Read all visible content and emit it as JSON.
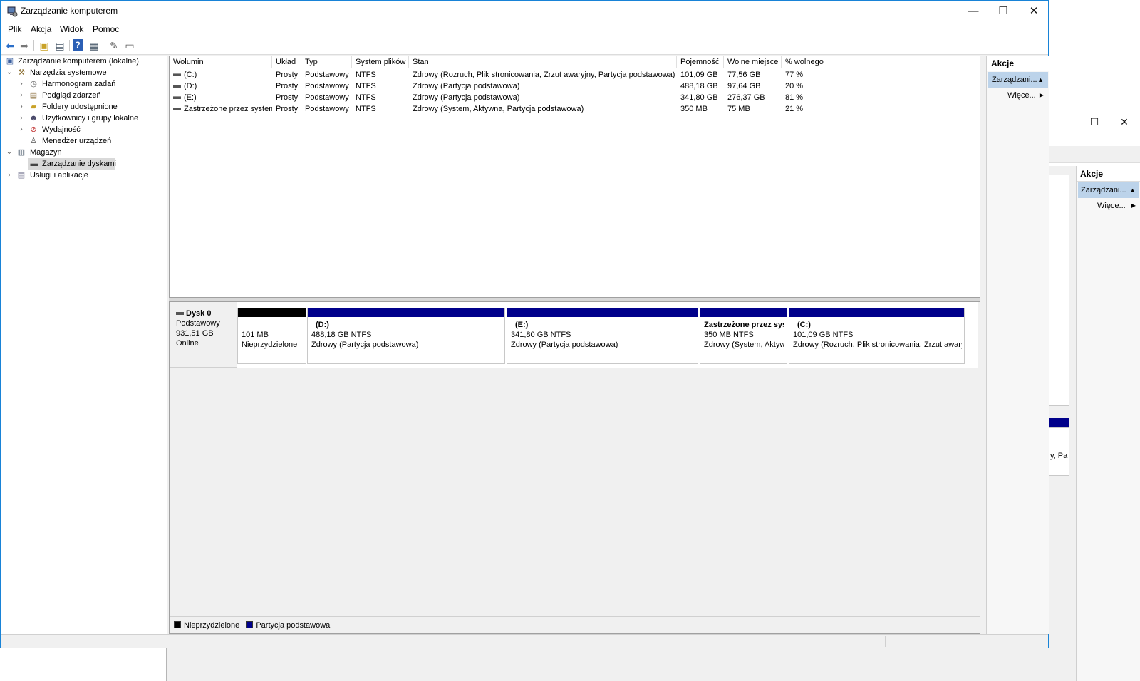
{
  "window": {
    "title": "Zarządzanie komputerem",
    "minimize": "—",
    "maximize": "☐",
    "close": "✕"
  },
  "menu": [
    "Plik",
    "Akcja",
    "Widok",
    "Pomoc"
  ],
  "tree": {
    "root": "Zarządzanie komputerem (lokalne)",
    "items": [
      {
        "label": "Narzędzia systemowe"
      },
      {
        "label": "Harmonogram zadań"
      },
      {
        "label": "Podgląd zdarzeń"
      },
      {
        "label": "Foldery udostępnione"
      },
      {
        "label": "Użytkownicy i grupy lokalne"
      },
      {
        "label": "Wydajność"
      },
      {
        "label": "Menedżer urządzeń"
      },
      {
        "label": "Magazyn"
      },
      {
        "label": "Zarządzanie dyskami"
      },
      {
        "label": "Usługi i aplikacje"
      }
    ]
  },
  "volumes": {
    "columns": [
      "Wolumin",
      "Układ",
      "Typ",
      "System plików",
      "Stan",
      "Pojemność",
      "Wolne miejsce",
      "% wolnego"
    ],
    "rows": [
      [
        "(C:)",
        "Prosty",
        "Podstawowy",
        "NTFS",
        "Zdrowy (Rozruch, Plik stronicowania, Zrzut awaryjny, Partycja podstawowa)",
        "101,09 GB",
        "77,56 GB",
        "77 %"
      ],
      [
        "(D:)",
        "Prosty",
        "Podstawowy",
        "NTFS",
        "Zdrowy (Partycja podstawowa)",
        "488,18 GB",
        "97,64 GB",
        "20 %"
      ],
      [
        "(E:)",
        "Prosty",
        "Podstawowy",
        "NTFS",
        "Zdrowy (Partycja podstawowa)",
        "341,80 GB",
        "276,37 GB",
        "81 %"
      ],
      [
        "Zastrzeżone przez system",
        "Prosty",
        "Podstawowy",
        "NTFS",
        "Zdrowy (System, Aktywna, Partycja podstawowa)",
        "350 MB",
        "75 MB",
        "21 %"
      ]
    ]
  },
  "disk": {
    "name": "Dysk 0",
    "type": "Podstawowy",
    "size": "931,51 GB",
    "status": "Online",
    "partitions": [
      {
        "title": "",
        "size": "101 MB",
        "status": "Nieprzydzielone",
        "color": "#000000"
      },
      {
        "title": "(D:)",
        "size": "488,18 GB NTFS",
        "status": "Zdrowy (Partycja podstawowa)",
        "color": "#00008b"
      },
      {
        "title": "(E:)",
        "size": "341,80 GB NTFS",
        "status": "Zdrowy (Partycja podstawowa)",
        "color": "#00008b"
      },
      {
        "title": "Zastrzeżone przez sys",
        "size": "350 MB NTFS",
        "status": "Zdrowy (System, Aktyw",
        "color": "#00008b"
      },
      {
        "title": "(C:)",
        "size": "101,09 GB NTFS",
        "status": "Zdrowy (Rozruch, Plik stronicowania, Zrzut awary",
        "color": "#00008b"
      }
    ]
  },
  "legend": [
    {
      "label": "Nieprzydzielone",
      "color": "#000000"
    },
    {
      "label": "Partycja podstawowa",
      "color": "#00008b"
    }
  ],
  "actions": {
    "title": "Akcje",
    "section": "Zarządzani...",
    "more": "Więce..."
  },
  "background_window": {
    "actions_title": "Akcje",
    "section": "Zarządzani...",
    "more": "Więce...",
    "partition_fragment": "y, Pa"
  },
  "colors": {
    "primary_partition": "#00008b",
    "unallocated": "#000000",
    "window_border": "#1883d7",
    "selected_action": "#bcd3ea"
  }
}
